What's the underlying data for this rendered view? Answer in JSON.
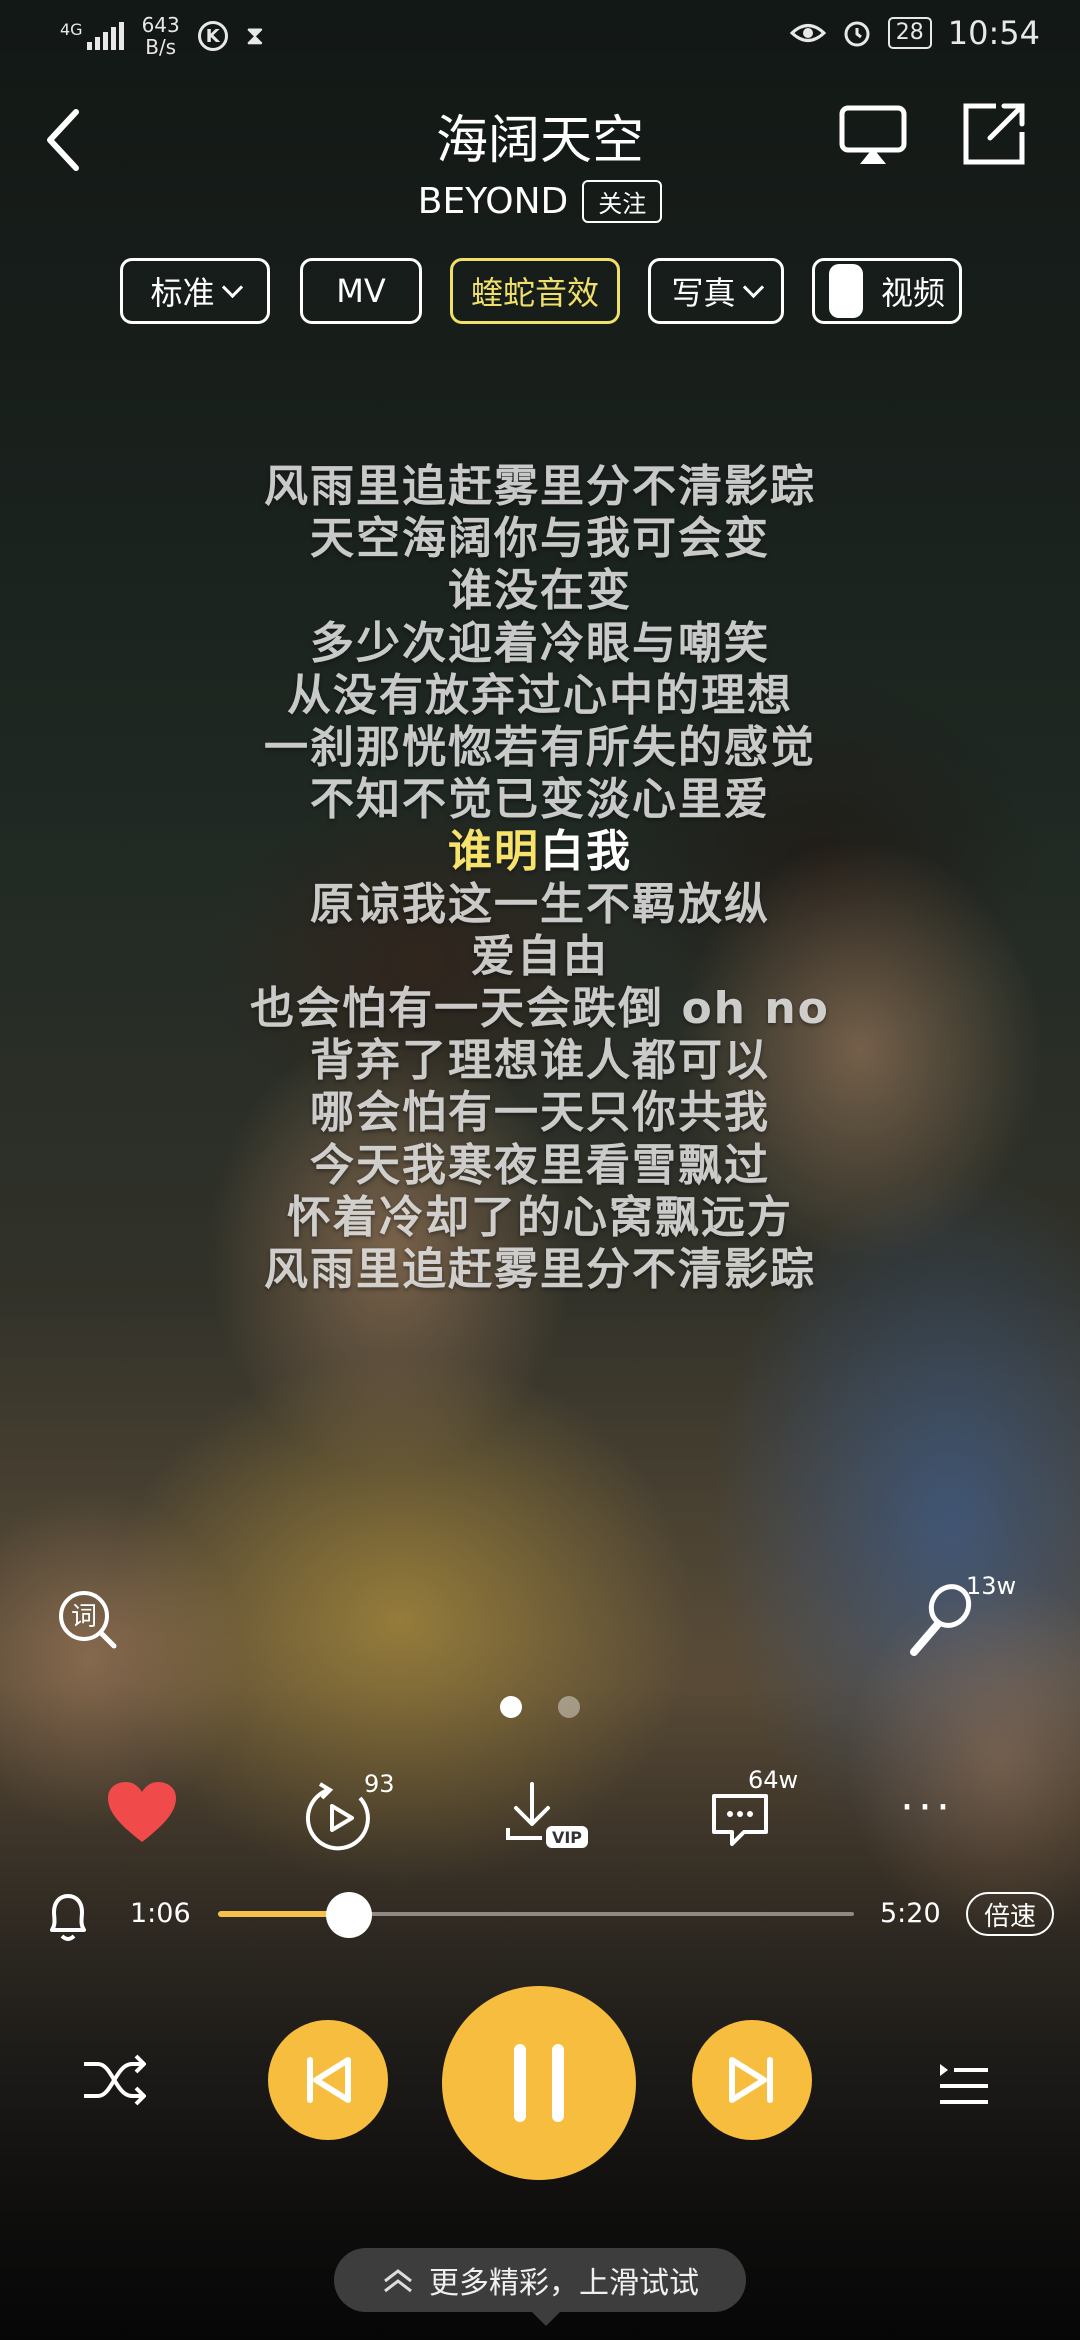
{
  "status_bar": {
    "network": "4G",
    "speed_value": "643",
    "speed_unit": "B/s",
    "k_label": "K",
    "battery": "28",
    "time": "10:54"
  },
  "header": {
    "title": "海阔天空",
    "artist": "BEYOND",
    "follow_label": "关注"
  },
  "chips": {
    "quality": "标准",
    "mv": "MV",
    "effect": "蝰蛇音效",
    "photo": "写真",
    "video": "视频"
  },
  "lyrics": [
    "风雨里追赶雾里分不清影踪",
    "天空海阔你与我可会变",
    "谁没在变",
    "多少次迎着冷眼与嘲笑",
    "从没有放弃过心中的理想",
    "一刹那恍惚若有所失的感觉",
    "不知不觉已变淡心里爱",
    "谁明白我",
    "原谅我这一生不羁放纵",
    "爱自由",
    "也会怕有一天会跌倒 oh no",
    "背弃了理想谁人都可以",
    "哪会怕有一天只你共我",
    "今天我寒夜里看雪飘过",
    "怀着冷却了的心窝飘远方",
    "风雨里追赶雾里分不清影踪"
  ],
  "current_lyric": {
    "sung": "谁明",
    "rest": "白我"
  },
  "side": {
    "lyric_icon_char": "词",
    "sing_count": "13w"
  },
  "actions": {
    "replay_count": "93",
    "download_vip": "VIP",
    "comment_count": "64w",
    "more_label": "···"
  },
  "progress": {
    "elapsed": "1:06",
    "total": "5:20",
    "fraction": 0.206,
    "speed_label": "倍速"
  },
  "bottom": {
    "more_hint": "更多精彩，上滑试试"
  },
  "colors": {
    "accent": "#f6bd3e",
    "highlight_lyric": "#f7e36b",
    "heart": "#f04a4a"
  }
}
